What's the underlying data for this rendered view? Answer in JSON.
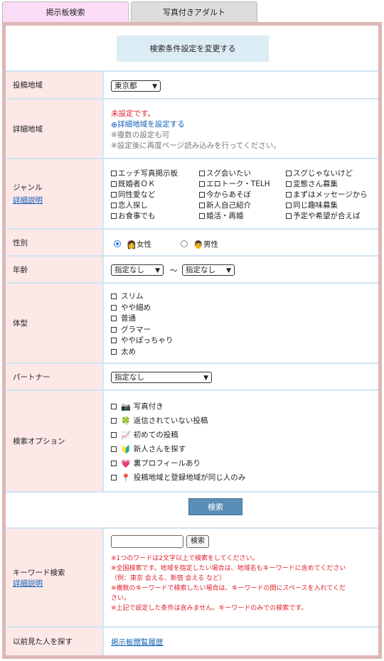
{
  "tabs": [
    "掲示板検索",
    "写真付きアダルト"
  ],
  "change_button": "検索条件設定を変更する",
  "region": {
    "label": "投稿地域",
    "value": "東京都"
  },
  "detail": {
    "label": "詳細地域",
    "status": "未設定です。",
    "link": "詳細地域を設定する",
    "note1": "※複数の設定も可",
    "note2": "※設定後に再度ページ読み込みを行ってください。"
  },
  "genre": {
    "label": "ジャンル",
    "help": "詳細説明",
    "items": [
      "エッチ写真掲示板",
      "スグ会いたい",
      "スグじゃないけど",
      "既婚者ＯＫ",
      "エロトーク・TELH",
      "変態さん募集",
      "同性愛など",
      "今からあそぼ",
      "まずはメッセージから",
      "恋人探し",
      "新人自己紹介",
      "同じ趣味募集",
      "お食事でも",
      "婚活・再婚",
      "予定や希望が合えば"
    ]
  },
  "gender": {
    "label": "性別",
    "female": "女性",
    "male": "男性",
    "selected": "female"
  },
  "age": {
    "label": "年齢",
    "from": "指定なし",
    "to": "指定なし",
    "sep": "〜"
  },
  "body": {
    "label": "体型",
    "items": [
      "スリム",
      "やや細め",
      "普通",
      "グラマー",
      "ややぽっちゃり",
      "太め"
    ]
  },
  "partner": {
    "label": "パートナー",
    "value": "指定なし"
  },
  "options": {
    "label": "検索オプション",
    "items": [
      {
        "icon": "camera-icon",
        "glyph": "📷",
        "text": "写真付き"
      },
      {
        "icon": "clover-icon",
        "glyph": "🍀",
        "text": "返信されていない投稿"
      },
      {
        "icon": "chart-icon",
        "glyph": "📈",
        "text": "初めての投稿"
      },
      {
        "icon": "beginner-icon",
        "glyph": "🔰",
        "text": "新人さんを探す"
      },
      {
        "icon": "heart-icon",
        "glyph": "💗",
        "text": "裏プロフィールあり"
      },
      {
        "icon": "pin-icon",
        "glyph": "📍",
        "text": "投稿地域と登録地域が同じ人のみ"
      }
    ]
  },
  "search_button": "検索",
  "keyword": {
    "label": "キーワード検索",
    "help": "詳細説明",
    "button": "検索",
    "notes": [
      "※1つのワードは2文字以上で検索をしてください。",
      "※全国検索です。地域を指定したい場合は、地域名もキーワードに含めてください",
      "（例：東京 会える、新宿 会える など）",
      "※複数のキーワードで検索したい場合は、キーワードの間にスペースを入れてくだ",
      "さい。",
      "※上記で設定した条件は含みません。キーワードのみでの検索です。"
    ]
  },
  "history": {
    "label": "以前見た人を探す",
    "link": "掲示板閲覧履歴"
  },
  "colors": {
    "accent_pink": "#fde8e8",
    "frame": "#deb6b6",
    "link": "#1160b8",
    "alert": "#e0202c",
    "button": "#5b8eb7"
  }
}
